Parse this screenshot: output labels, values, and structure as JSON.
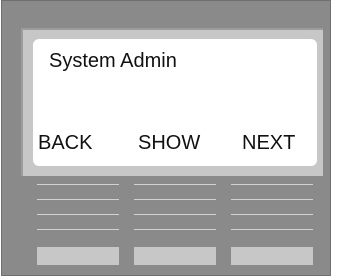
{
  "screen": {
    "title": "System Admin",
    "softkeys": {
      "back": "BACK",
      "show": "SHOW",
      "next": "NEXT"
    }
  }
}
